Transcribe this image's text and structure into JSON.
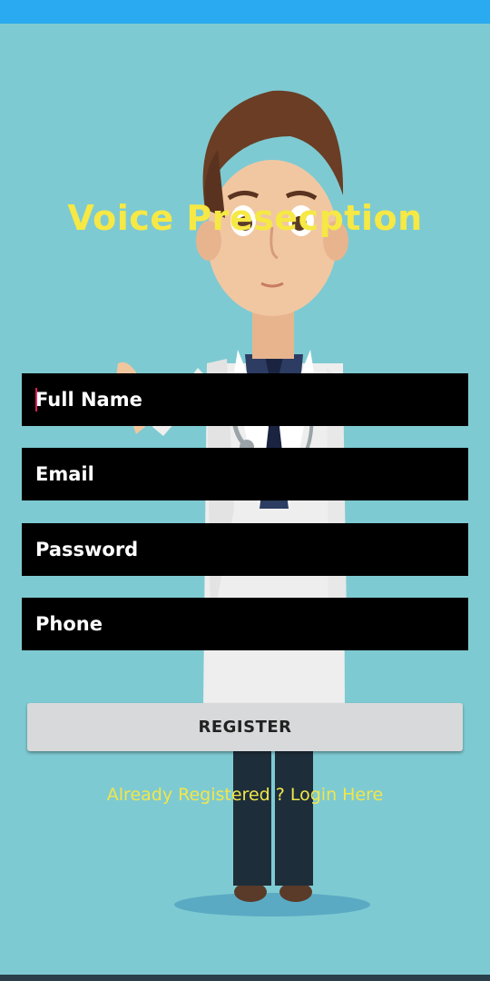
{
  "app": {
    "title": "Voice Presecption"
  },
  "form": {
    "full_name_placeholder": "Full Name",
    "email_placeholder": "Email",
    "password_placeholder": "Password",
    "phone_placeholder": "Phone",
    "register_label": "REGISTER",
    "login_link": "Already Registered ? Login Here"
  },
  "colors": {
    "background": "#7ecad2",
    "status_bar": "#2aaaf0",
    "title": "#f6e845",
    "field_background": "#000000",
    "button_background": "#d8d9da",
    "link": "#f1e64a"
  }
}
